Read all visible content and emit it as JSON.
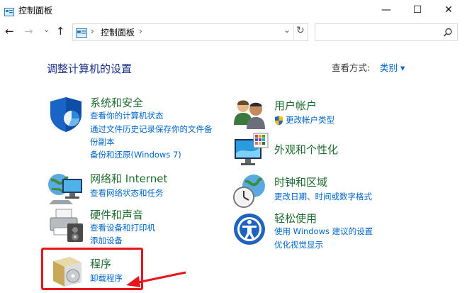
{
  "window": {
    "title": "控制面板",
    "minimize": "—",
    "maximize": "☐",
    "close": "✕"
  },
  "nav": {
    "back": "←",
    "forward": "→",
    "recent": "⌄",
    "up": "↑",
    "refresh": "↻",
    "dropdown": "⌄"
  },
  "address": {
    "path": "控制面板",
    "separator": "›"
  },
  "search": {
    "placeholder": ""
  },
  "page": {
    "heading": "调整计算机的设置",
    "view_by_label": "查看方式:",
    "view_by_value": "类别 ▾"
  },
  "categories": {
    "system": {
      "title": "系统和安全",
      "links": [
        "查看你的计算机状态",
        "通过文件历史记录保存你的文件备",
        "份副本",
        "备份和还原(Windows 7)"
      ]
    },
    "network": {
      "title": "网络和 Internet",
      "links": [
        "查看网络状态和任务"
      ]
    },
    "hardware": {
      "title": "硬件和声音",
      "links": [
        "查看设备和打印机",
        "添加设备"
      ]
    },
    "programs": {
      "title": "程序",
      "links": [
        "卸载程序"
      ]
    },
    "users": {
      "title": "用户帐户",
      "links": [
        "更改帐户类型"
      ]
    },
    "appearance": {
      "title": "外观和个性化",
      "links": []
    },
    "clock": {
      "title": "时钟和区域",
      "links": [
        "更改日期、时间或数字格式"
      ]
    },
    "ease": {
      "title": "轻松使用",
      "links": [
        "使用 Windows 建议的设置",
        "优化视觉显示"
      ]
    }
  },
  "colors": {
    "heading": "#1e3287",
    "category": "#1e6b2e",
    "link": "#0066cc",
    "highlight": "#e8161c"
  }
}
